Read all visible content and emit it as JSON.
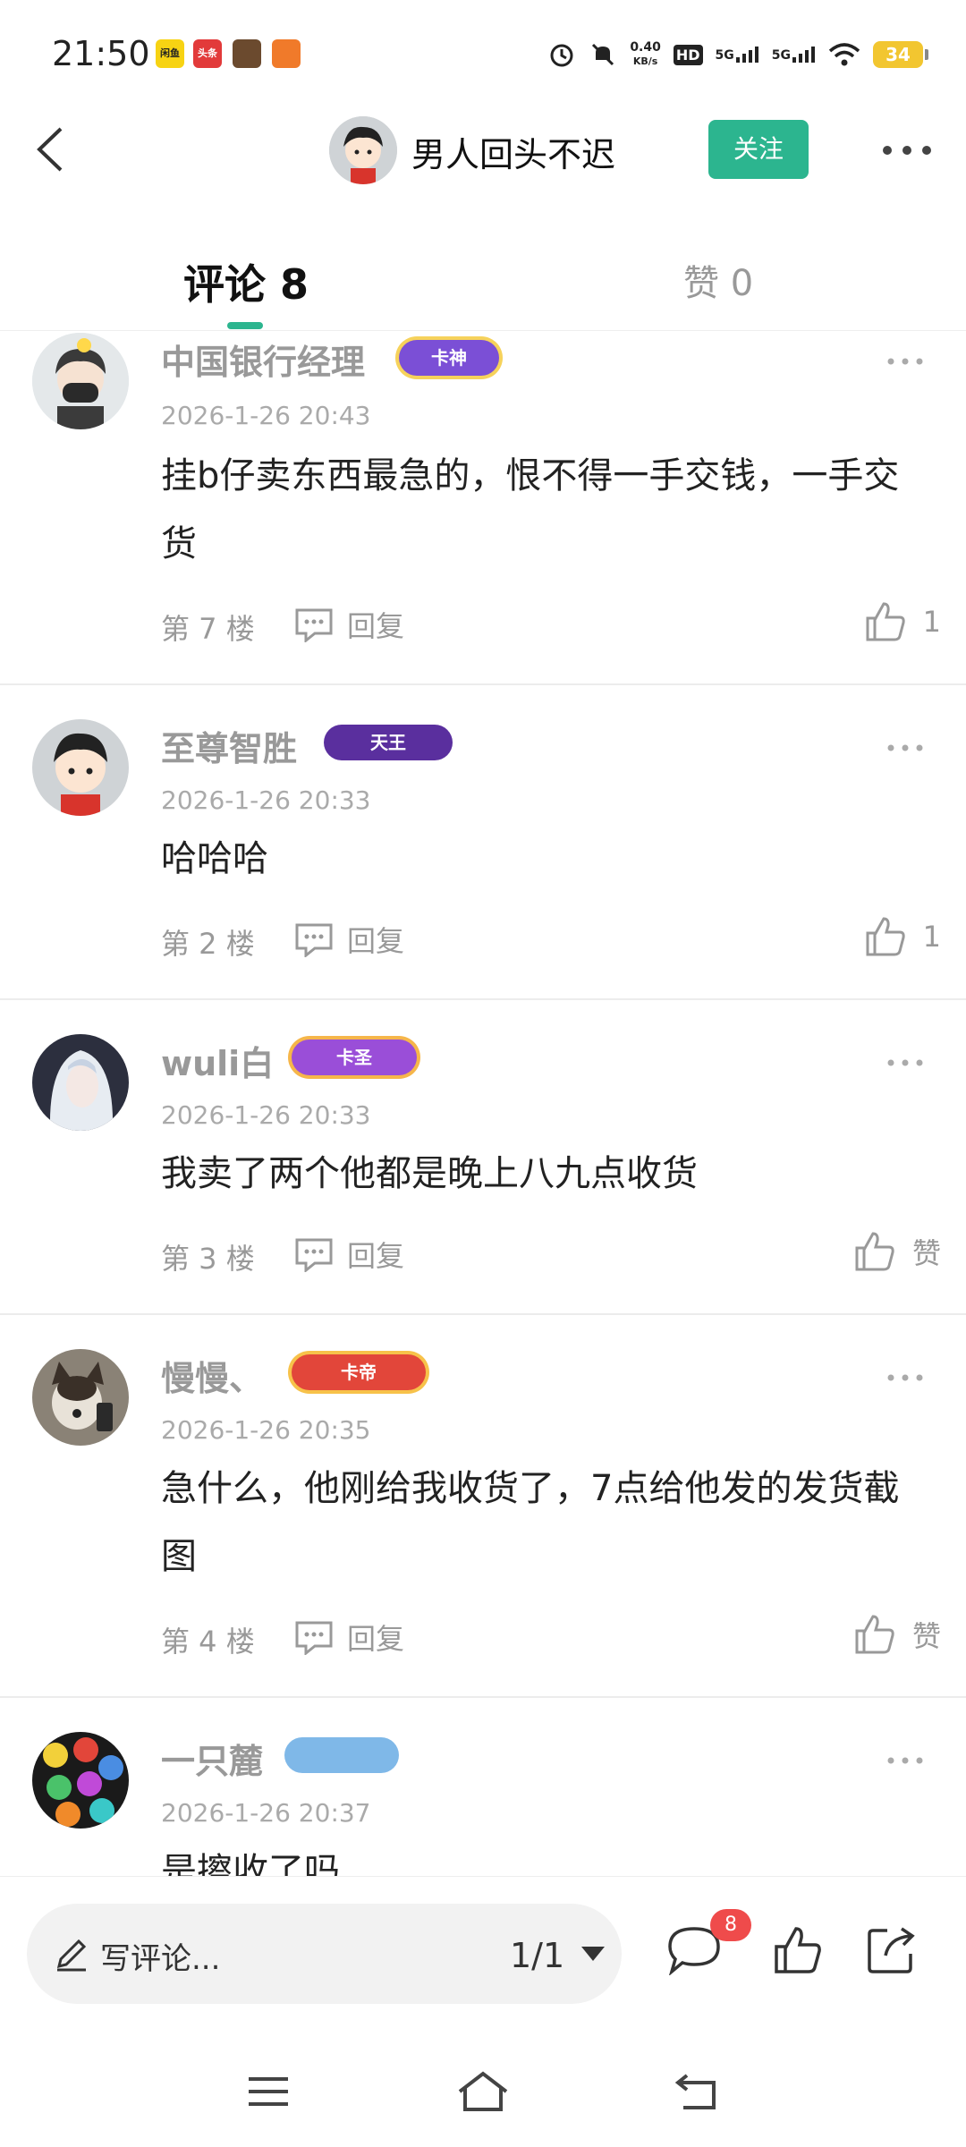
{
  "status_bar": {
    "time": "21:50",
    "app_icons": [
      "闲鱼",
      "头条",
      "",
      ""
    ],
    "network_speed_value": "0.40",
    "network_speed_unit": "KB/s",
    "hd_label": "HD",
    "signal1": "5G",
    "signal2": "5G",
    "battery": "34"
  },
  "header": {
    "author_name": "男人回头不迟",
    "follow_label": "关注"
  },
  "tabs": {
    "comments_label": "评论 8",
    "likes_label": "赞 0"
  },
  "comments": [
    {
      "name": "中国银行经理",
      "badge": "卡神",
      "badge_color": "#7b4fd6",
      "time": "2026-1-26 20:43",
      "text": "挂b仔卖东西最急的，恨不得一手交钱，一手交货",
      "floor": "第 7 楼",
      "reply_label": "回复",
      "like_label": "1"
    },
    {
      "name": "至尊智胜",
      "badge": "天王",
      "badge_color": "#5a2f9e",
      "time": "2026-1-26 20:33",
      "text": "哈哈哈",
      "floor": "第 2 楼",
      "reply_label": "回复",
      "like_label": "1"
    },
    {
      "name": "wuli白",
      "badge": "卡圣",
      "badge_color": "#9a4ed8",
      "time": "2026-1-26 20:33",
      "text": "我卖了两个他都是晚上八九点收货",
      "floor": "第 3 楼",
      "reply_label": "回复",
      "like_label": "赞"
    },
    {
      "name": "慢慢、",
      "badge": "卡帝",
      "badge_color": "#e2463a",
      "time": "2026-1-26 20:35",
      "text": "急什么，他刚给我收货了，7点给他发的发货截图",
      "floor": "第 4 楼",
      "reply_label": "回复",
      "like_label": "赞"
    },
    {
      "name": "一只麓",
      "badge": "",
      "badge_color": "#7fb8e8",
      "time": "2026-1-26 20:37",
      "text": "是擦收了吗",
      "floor": "",
      "reply_label": "",
      "like_label": ""
    }
  ],
  "bottom_bar": {
    "input_placeholder": "写评论...",
    "page_indicator": "1/1",
    "comment_count": "8"
  },
  "colors": {
    "accent": "#2cb58f",
    "badge_red": "#ef4b4b"
  },
  "icons": {
    "back": "chevron-left-icon",
    "more": "more-dots-icon",
    "reply": "reply-bubble-icon",
    "like": "thumbs-up-icon",
    "share": "share-icon",
    "pen": "pen-icon",
    "dropdown": "caret-down-icon",
    "nav_menu": "menu-icon",
    "nav_home": "home-icon",
    "nav_back": "back-arrow-icon"
  }
}
